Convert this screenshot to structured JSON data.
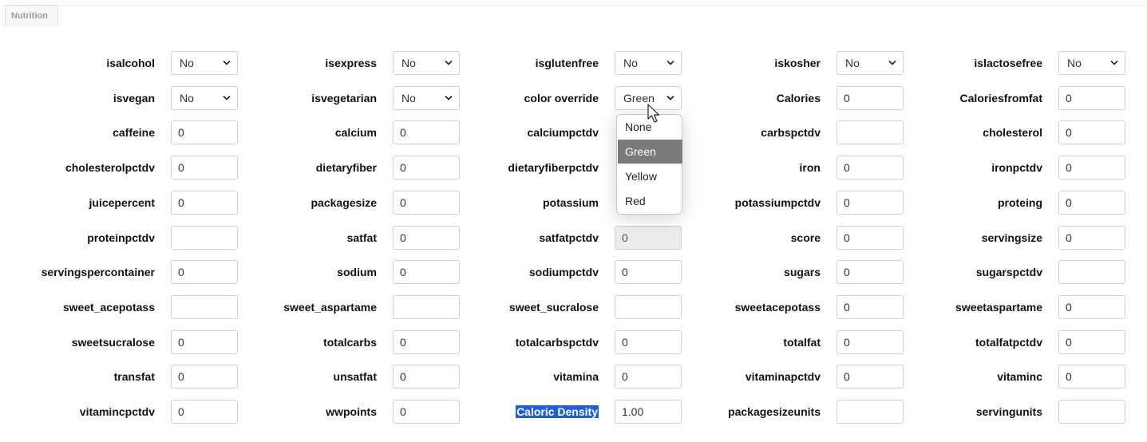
{
  "tab": {
    "label": "Nutrition"
  },
  "dropdown_options": [
    "None",
    "Green",
    "Yellow",
    "Red"
  ],
  "dropdown_selected": "Green",
  "rows": [
    [
      {
        "label": "isalcohol",
        "type": "select",
        "value": "No"
      },
      {
        "label": "isexpress",
        "type": "select",
        "value": "No"
      },
      {
        "label": "isglutenfree",
        "type": "select",
        "value": "No"
      },
      {
        "label": "iskosher",
        "type": "select",
        "value": "No"
      },
      {
        "label": "islactosefree",
        "type": "select",
        "value": "No"
      }
    ],
    [
      {
        "label": "isvegan",
        "type": "select",
        "value": "No"
      },
      {
        "label": "isvegetarian",
        "type": "select",
        "value": "No"
      },
      {
        "label": "color override",
        "type": "select",
        "value": "Green"
      },
      {
        "label": "Calories",
        "type": "input",
        "value": "0"
      },
      {
        "label": "Caloriesfromfat",
        "type": "input",
        "value": "0"
      }
    ],
    [
      {
        "label": "caffeine",
        "type": "input",
        "value": "0"
      },
      {
        "label": "calcium",
        "type": "input",
        "value": "0"
      },
      {
        "label": "calciumpctdv",
        "type": "hidden",
        "value": ""
      },
      {
        "label": "carbspctdv",
        "type": "input",
        "value": ""
      },
      {
        "label": "cholesterol",
        "type": "input",
        "value": "0"
      }
    ],
    [
      {
        "label": "cholesterolpctdv",
        "type": "input",
        "value": "0"
      },
      {
        "label": "dietaryfiber",
        "type": "input",
        "value": "0"
      },
      {
        "label": "dietaryfiberpctdv",
        "type": "hidden",
        "value": ""
      },
      {
        "label": "iron",
        "type": "input",
        "value": "0"
      },
      {
        "label": "ironpctdv",
        "type": "input",
        "value": "0"
      }
    ],
    [
      {
        "label": "juicepercent",
        "type": "input",
        "value": "0"
      },
      {
        "label": "packagesize",
        "type": "input",
        "value": "0"
      },
      {
        "label": "potassium",
        "type": "hidden",
        "value": ""
      },
      {
        "label": "potassiumpctdv",
        "type": "input",
        "value": "0"
      },
      {
        "label": "proteing",
        "type": "input",
        "value": "0"
      }
    ],
    [
      {
        "label": "proteinpctdv",
        "type": "input",
        "value": ""
      },
      {
        "label": "satfat",
        "type": "input",
        "value": "0"
      },
      {
        "label": "satfatpctdv",
        "type": "disabled",
        "value": "0"
      },
      {
        "label": "score",
        "type": "input",
        "value": "0"
      },
      {
        "label": "servingsize",
        "type": "input",
        "value": "0"
      }
    ],
    [
      {
        "label": "servingspercontainer",
        "type": "input",
        "value": "0"
      },
      {
        "label": "sodium",
        "type": "input",
        "value": "0"
      },
      {
        "label": "sodiumpctdv",
        "type": "input",
        "value": "0"
      },
      {
        "label": "sugars",
        "type": "input",
        "value": "0"
      },
      {
        "label": "sugarspctdv",
        "type": "input",
        "value": ""
      }
    ],
    [
      {
        "label": "sweet_acepotass",
        "type": "input",
        "value": ""
      },
      {
        "label": "sweet_aspartame",
        "type": "input",
        "value": ""
      },
      {
        "label": "sweet_sucralose",
        "type": "input",
        "value": ""
      },
      {
        "label": "sweetacepotass",
        "type": "input",
        "value": "0"
      },
      {
        "label": "sweetaspartame",
        "type": "input",
        "value": "0"
      }
    ],
    [
      {
        "label": "sweetsucralose",
        "type": "input",
        "value": "0"
      },
      {
        "label": "totalcarbs",
        "type": "input",
        "value": "0"
      },
      {
        "label": "totalcarbspctdv",
        "type": "input",
        "value": "0"
      },
      {
        "label": "totalfat",
        "type": "input",
        "value": "0"
      },
      {
        "label": "totalfatpctdv",
        "type": "input",
        "value": "0"
      }
    ],
    [
      {
        "label": "transfat",
        "type": "input",
        "value": "0"
      },
      {
        "label": "unsatfat",
        "type": "input",
        "value": "0"
      },
      {
        "label": "vitamina",
        "type": "input",
        "value": "0"
      },
      {
        "label": "vitaminapctdv",
        "type": "input",
        "value": "0"
      },
      {
        "label": "vitaminc",
        "type": "input",
        "value": "0"
      }
    ],
    [
      {
        "label": "vitamincpctdv",
        "type": "input",
        "value": "0"
      },
      {
        "label": "wwpoints",
        "type": "input",
        "value": "0"
      },
      {
        "label": "Caloric Density",
        "type": "input",
        "value": "1.00",
        "label_selected": true
      },
      {
        "label": "packagesizeunits",
        "type": "input",
        "value": ""
      },
      {
        "label": "servingunits",
        "type": "input",
        "value": ""
      }
    ]
  ],
  "icons": {
    "chevron": "chevron-down-icon",
    "cursor": "mouse-pointer-icon"
  }
}
